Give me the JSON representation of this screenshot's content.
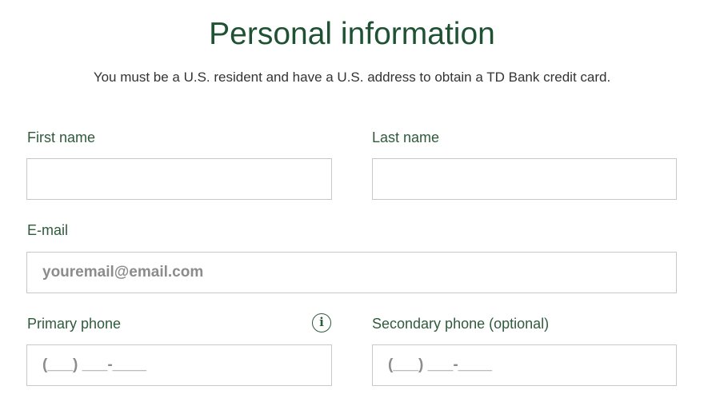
{
  "header": {
    "title": "Personal information",
    "subtitle": "You must be a U.S. resident and have a U.S. address to obtain a TD Bank credit card."
  },
  "form": {
    "first_name": {
      "label": "First name",
      "value": "",
      "placeholder": ""
    },
    "last_name": {
      "label": "Last name",
      "value": "",
      "placeholder": ""
    },
    "email": {
      "label": "E-mail",
      "value": "",
      "placeholder": "youremail@email.com"
    },
    "primary_phone": {
      "label": "Primary phone",
      "value": "",
      "placeholder": "(___) ___-____",
      "info_icon": "info-icon",
      "info_glyph": "i"
    },
    "secondary_phone": {
      "label": "Secondary phone (optional)",
      "value": "",
      "placeholder": "(___) ___-____"
    }
  },
  "colors": {
    "title": "#1f5232",
    "label": "#2f5a3b",
    "border": "#c8c8c8",
    "placeholder": "#8c8c8c"
  }
}
